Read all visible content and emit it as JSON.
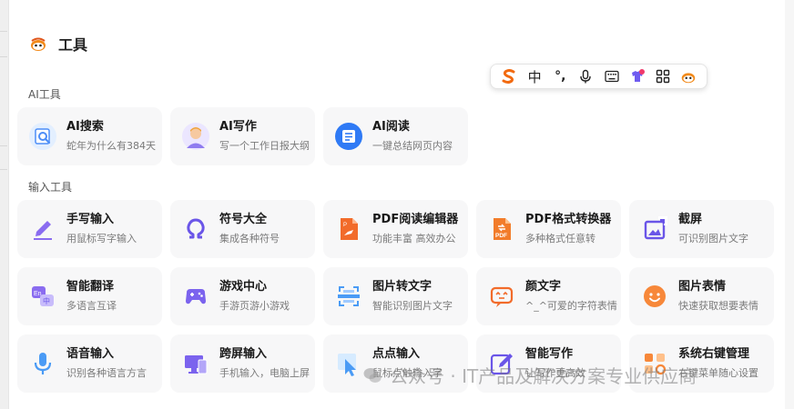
{
  "header": {
    "title": "工具"
  },
  "toolbar": {
    "items": [
      {
        "icon": "sogou-s-icon"
      },
      {
        "label": "中",
        "icon": "chinese-mode-icon"
      },
      {
        "label": "°,",
        "icon": "punctuation-icon"
      },
      {
        "icon": "microphone-icon"
      },
      {
        "icon": "keyboard-icon"
      },
      {
        "icon": "skin-icon"
      },
      {
        "icon": "grid-icon"
      },
      {
        "icon": "mascot-icon"
      }
    ]
  },
  "sections": [
    {
      "label": "AI工具",
      "tools": [
        {
          "name": "AI搜索",
          "desc": "蛇年为什么有384天",
          "icon": "ai-search-icon"
        },
        {
          "name": "AI写作",
          "desc": "写一个工作日报大纲",
          "icon": "ai-writing-icon"
        },
        {
          "name": "AI阅读",
          "desc": "一键总结网页内容",
          "icon": "ai-reading-icon"
        }
      ]
    },
    {
      "label": "输入工具",
      "tools": [
        {
          "name": "手写输入",
          "desc": "用鼠标写字输入",
          "icon": "handwriting-icon"
        },
        {
          "name": "符号大全",
          "desc": "集成各种符号",
          "icon": "symbol-icon"
        },
        {
          "name": "PDF阅读编辑器",
          "desc": "功能丰富 高效办公",
          "icon": "pdf-reader-icon"
        },
        {
          "name": "PDF格式转换器",
          "desc": "多种格式任意转",
          "icon": "pdf-converter-icon"
        },
        {
          "name": "截屏",
          "desc": "可识别图片文字",
          "icon": "screenshot-icon"
        },
        {
          "name": "智能翻译",
          "desc": "多语言互译",
          "icon": "translate-icon"
        },
        {
          "name": "游戏中心",
          "desc": "手游页游小游戏",
          "icon": "game-icon"
        },
        {
          "name": "图片转文字",
          "desc": "智能识别图片文字",
          "icon": "ocr-icon"
        },
        {
          "name": "颜文字",
          "desc": "^_^可爱的字符表情",
          "icon": "kaomoji-icon"
        },
        {
          "name": "图片表情",
          "desc": "快速获取想要表情",
          "icon": "sticker-icon"
        },
        {
          "name": "语音输入",
          "desc": "识别各种语言方言",
          "icon": "voice-input-icon"
        },
        {
          "name": "跨屏输入",
          "desc": "手机输入，电脑上屏",
          "icon": "cross-screen-icon"
        },
        {
          "name": "点点输入",
          "desc": "鼠标点触输入字",
          "icon": "click-input-icon"
        },
        {
          "name": "智能写作",
          "desc": "让写作更高效",
          "icon": "smart-writing-icon"
        },
        {
          "name": "系统右键管理",
          "desc": "右键菜单随心设置",
          "icon": "right-click-icon"
        }
      ]
    }
  ],
  "watermark": {
    "text": "公众号 · IT产品及解决方案专业供应商"
  }
}
